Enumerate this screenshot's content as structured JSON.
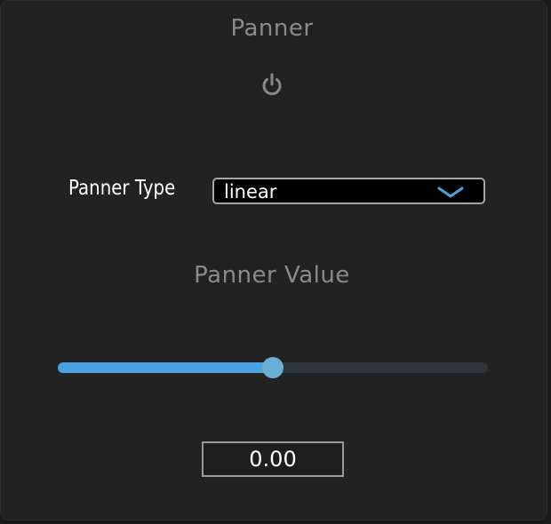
{
  "panel": {
    "title": "Panner",
    "power_icon": "power-icon"
  },
  "panner_type": {
    "label": "Panner Type",
    "selected": "linear",
    "chevron_icon": "chevron-down-icon"
  },
  "panner_value": {
    "title": "Panner Value",
    "slider_fraction": 0.5,
    "display": "0.00"
  },
  "colors": {
    "background": "#222222",
    "accent": "#4aa3e0",
    "thumb": "#6aaed6",
    "track": "#2d353a",
    "muted_text": "#8a8a8a"
  }
}
